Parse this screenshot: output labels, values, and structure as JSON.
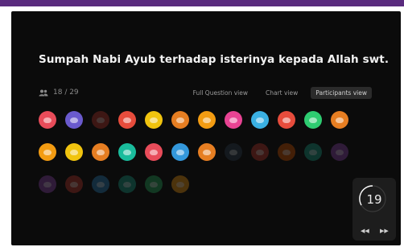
{
  "question": {
    "text": "Sumpah Nabi Ayub terhadap isterinya kepada Allah swt."
  },
  "participants": {
    "count_text": "18 / 29",
    "avatars_row1": [
      {
        "color": "#e84c5a",
        "dim": false
      },
      {
        "color": "#6a5acd",
        "dim": false
      },
      {
        "color": "#c0392b",
        "dim": true
      },
      {
        "color": "#e74c3c",
        "dim": false
      },
      {
        "color": "#f1c40f",
        "dim": false
      },
      {
        "color": "#e67e22",
        "dim": false
      },
      {
        "color": "#f39c12",
        "dim": false
      },
      {
        "color": "#e84393",
        "dim": false
      },
      {
        "color": "#3ab0e2",
        "dim": false
      },
      {
        "color": "#e74c3c",
        "dim": false
      },
      {
        "color": "#2ecc71",
        "dim": false
      },
      {
        "color": "#e67e22",
        "dim": false
      }
    ],
    "avatars_row2": [
      {
        "color": "#f39c12",
        "dim": false
      },
      {
        "color": "#f1c40f",
        "dim": false
      },
      {
        "color": "#e67e22",
        "dim": false
      },
      {
        "color": "#1abc9c",
        "dim": false
      },
      {
        "color": "#e84c5a",
        "dim": false
      },
      {
        "color": "#3498db",
        "dim": false
      },
      {
        "color": "#e67e22",
        "dim": false
      },
      {
        "color": "#2c3e50",
        "dim": true
      },
      {
        "color": "#c0392b",
        "dim": true
      },
      {
        "color": "#d35400",
        "dim": true
      },
      {
        "color": "#16a085",
        "dim": true
      },
      {
        "color": "#8e44ad",
        "dim": true
      }
    ],
    "avatars_row3": [
      {
        "color": "#8e44ad",
        "dim": true
      },
      {
        "color": "#c0392b",
        "dim": true
      },
      {
        "color": "#2980b9",
        "dim": true
      },
      {
        "color": "#16a085",
        "dim": true
      },
      {
        "color": "#27ae60",
        "dim": true
      },
      {
        "color": "#f39c12",
        "dim": true
      }
    ]
  },
  "views": {
    "full_question": "Full Question view",
    "chart": "Chart view",
    "participants": "Participants view"
  },
  "timer": {
    "value": "19",
    "ring_color": "#ffffff"
  }
}
